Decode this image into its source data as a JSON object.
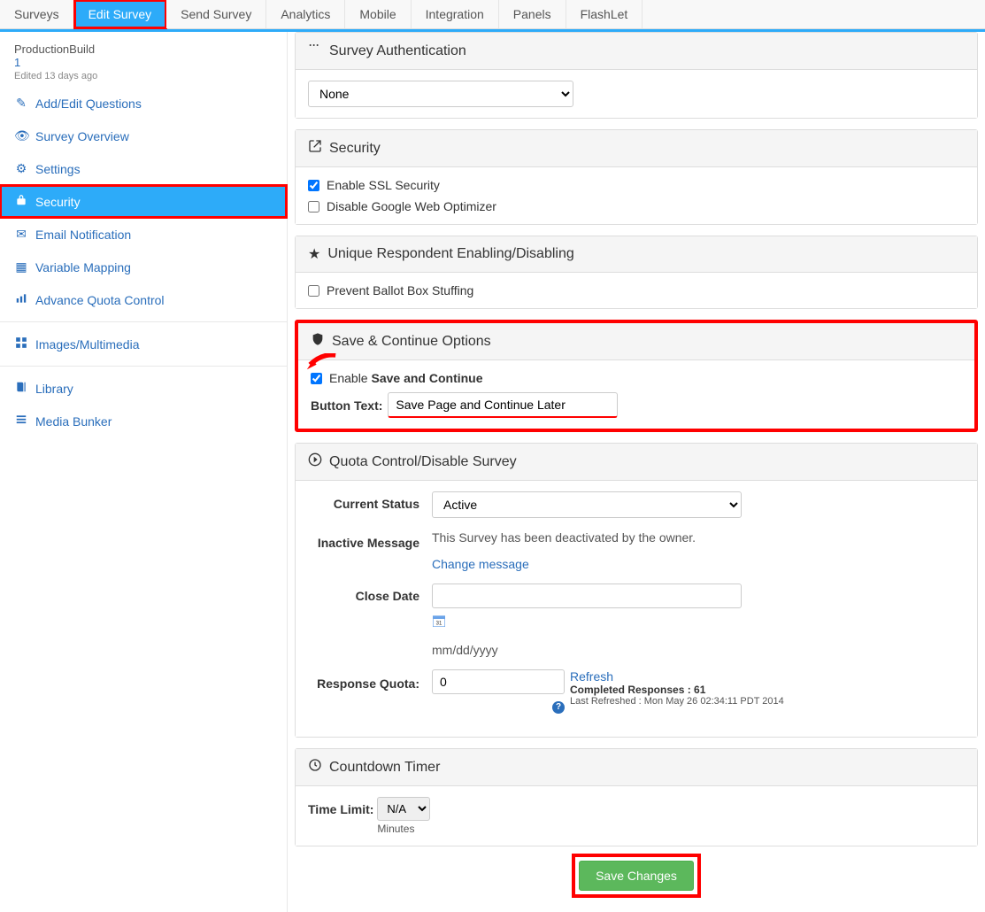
{
  "tabs": {
    "items": [
      {
        "label": "Surveys"
      },
      {
        "label": "Edit Survey"
      },
      {
        "label": "Send Survey"
      },
      {
        "label": "Analytics"
      },
      {
        "label": "Mobile"
      },
      {
        "label": "Integration"
      },
      {
        "label": "Panels"
      },
      {
        "label": "FlashLet"
      }
    ]
  },
  "sidebar": {
    "title": "ProductionBuild",
    "id": "1",
    "edited": "Edited 13 days ago",
    "items": [
      {
        "label": "Add/Edit Questions"
      },
      {
        "label": "Survey Overview"
      },
      {
        "label": "Settings"
      },
      {
        "label": "Security"
      },
      {
        "label": "Email Notification"
      },
      {
        "label": "Variable Mapping"
      },
      {
        "label": "Advance Quota Control"
      },
      {
        "label": "Images/Multimedia"
      },
      {
        "label": "Library"
      },
      {
        "label": "Media Bunker"
      }
    ]
  },
  "main": {
    "auth": {
      "title": "Survey Authentication",
      "selected": "None"
    },
    "security": {
      "title": "Security",
      "enable_ssl": "Enable SSL Security",
      "disable_optimizer": "Disable Google Web Optimizer"
    },
    "unique": {
      "title": "Unique Respondent Enabling/Disabling",
      "prevent": "Prevent Ballot Box Stuffing"
    },
    "save_continue": {
      "title": "Save & Continue Options",
      "enable_prefix": "Enable",
      "enable_bold": "Save and Continue",
      "button_text_label": "Button Text:",
      "button_text_value": "Save Page and Continue Later"
    },
    "quota": {
      "title": "Quota Control/Disable Survey",
      "status_label": "Current Status",
      "status_value": "Active",
      "inactive_label": "Inactive Message",
      "inactive_text": "This Survey has been deactivated by the owner.",
      "change_link": "Change message",
      "close_date_label": "Close Date",
      "close_date_value": "",
      "date_format": "mm/dd/yyyy",
      "response_quota_label": "Response Quota:",
      "response_quota_value": "0",
      "refresh": "Refresh",
      "completed": "Completed Responses : 61",
      "last_refreshed": "Last Refreshed : Mon May 26 02:34:11 PDT 2014"
    },
    "countdown": {
      "title": "Countdown Timer",
      "time_limit_label": "Time Limit:",
      "time_limit_value": "N/A",
      "minutes": "Minutes"
    },
    "save_button": "Save Changes"
  }
}
